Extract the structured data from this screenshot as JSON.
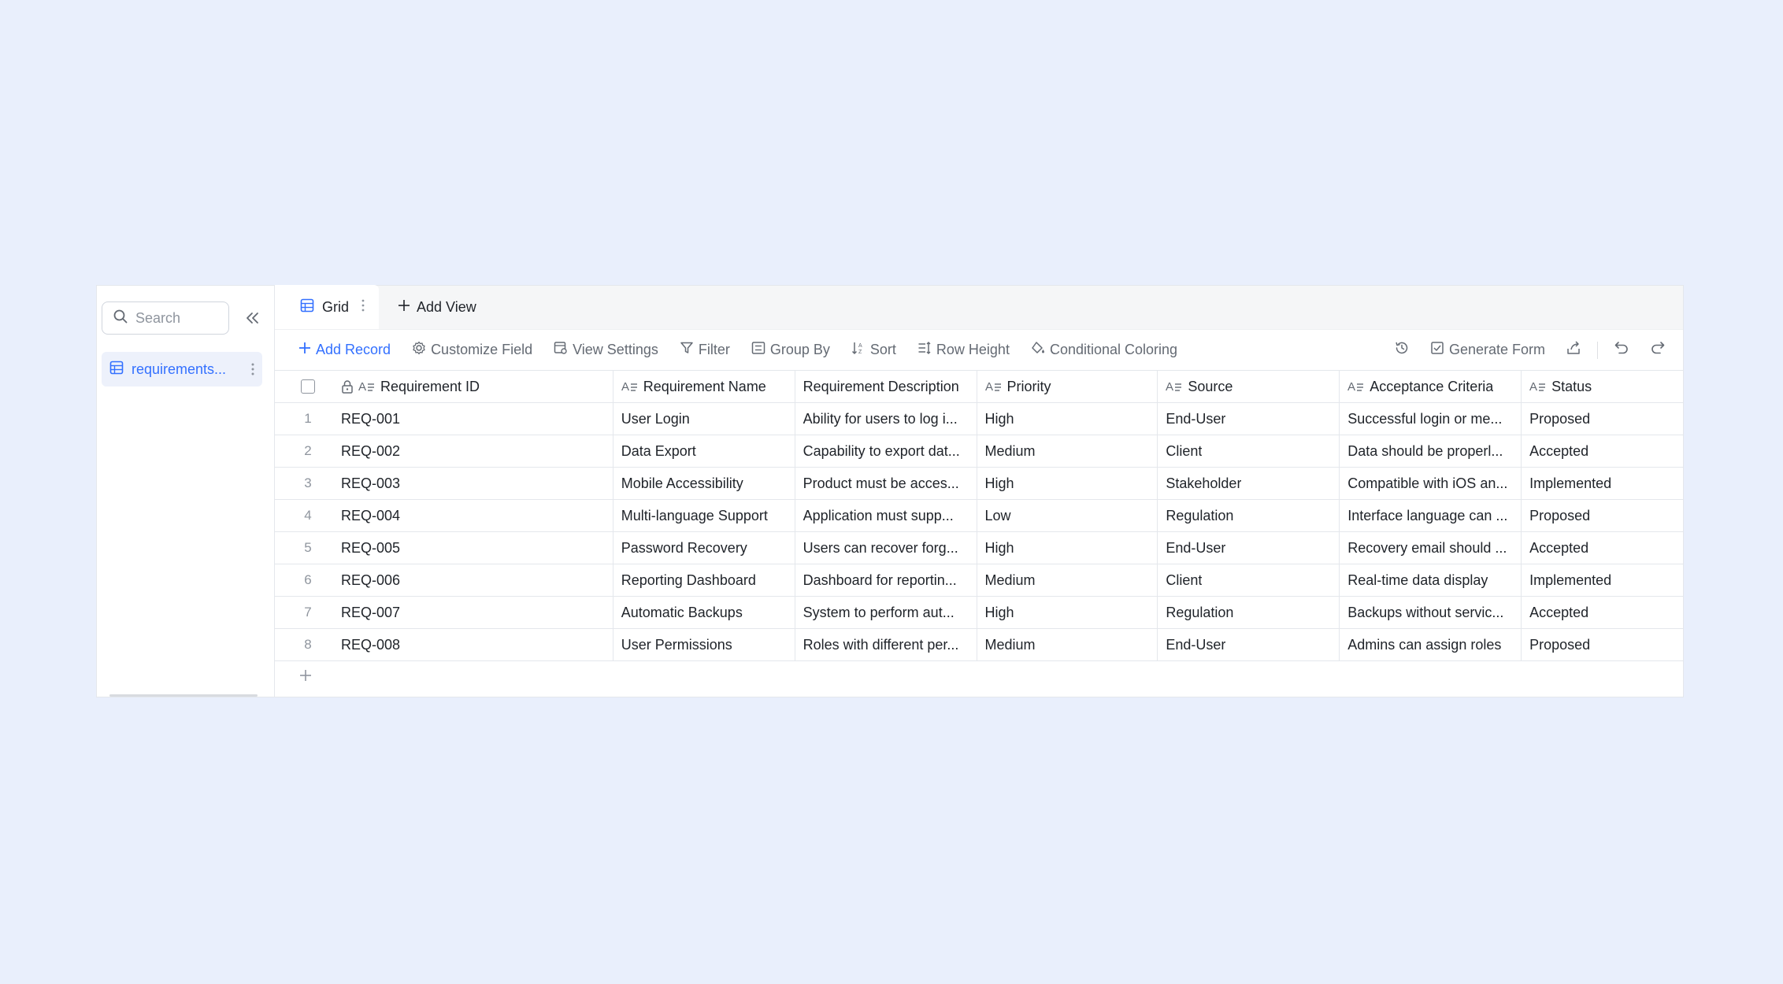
{
  "sidebar": {
    "search_placeholder": "Search",
    "table_label": "requirements..."
  },
  "tabs": {
    "grid_label": "Grid",
    "add_view_label": "Add View"
  },
  "toolbar": {
    "add_record": "Add Record",
    "customize_field": "Customize Field",
    "view_settings": "View Settings",
    "filter": "Filter",
    "group_by": "Group By",
    "sort": "Sort",
    "row_height": "Row Height",
    "conditional_coloring": "Conditional Coloring",
    "generate_form": "Generate Form"
  },
  "columns": {
    "id": "Requirement ID",
    "name": "Requirement Name",
    "desc": "Requirement Description",
    "priority": "Priority",
    "source": "Source",
    "acceptance": "Acceptance Criteria",
    "status": "Status"
  },
  "rows": [
    {
      "n": "1",
      "id": "REQ-001",
      "name": "User Login",
      "desc": "Ability for users to log i...",
      "priority": "High",
      "source": "End-User",
      "acceptance": "Successful login or me...",
      "status": "Proposed"
    },
    {
      "n": "2",
      "id": "REQ-002",
      "name": "Data Export",
      "desc": "Capability to export dat...",
      "priority": "Medium",
      "source": "Client",
      "acceptance": "Data should be properl...",
      "status": "Accepted"
    },
    {
      "n": "3",
      "id": "REQ-003",
      "name": "Mobile Accessibility",
      "desc": "Product must be acces...",
      "priority": "High",
      "source": "Stakeholder",
      "acceptance": "Compatible with iOS an...",
      "status": "Implemented"
    },
    {
      "n": "4",
      "id": "REQ-004",
      "name": "Multi-language Support",
      "desc": "Application must supp...",
      "priority": "Low",
      "source": "Regulation",
      "acceptance": "Interface language can ...",
      "status": "Proposed"
    },
    {
      "n": "5",
      "id": "REQ-005",
      "name": "Password Recovery",
      "desc": "Users can recover forg...",
      "priority": "High",
      "source": "End-User",
      "acceptance": "Recovery email should ...",
      "status": "Accepted"
    },
    {
      "n": "6",
      "id": "REQ-006",
      "name": "Reporting Dashboard",
      "desc": "Dashboard for reportin...",
      "priority": "Medium",
      "source": "Client",
      "acceptance": "Real-time data display",
      "status": "Implemented"
    },
    {
      "n": "7",
      "id": "REQ-007",
      "name": "Automatic Backups",
      "desc": "System to perform aut...",
      "priority": "High",
      "source": "Regulation",
      "acceptance": "Backups without servic...",
      "status": "Accepted"
    },
    {
      "n": "8",
      "id": "REQ-008",
      "name": "User Permissions",
      "desc": "Roles with different per...",
      "priority": "Medium",
      "source": "End-User",
      "acceptance": "Admins can assign roles",
      "status": "Proposed"
    }
  ],
  "colors": {
    "accent": "#3370ff",
    "background": "#e9effc",
    "border": "#e4e7ec",
    "muted": "#646a73"
  }
}
